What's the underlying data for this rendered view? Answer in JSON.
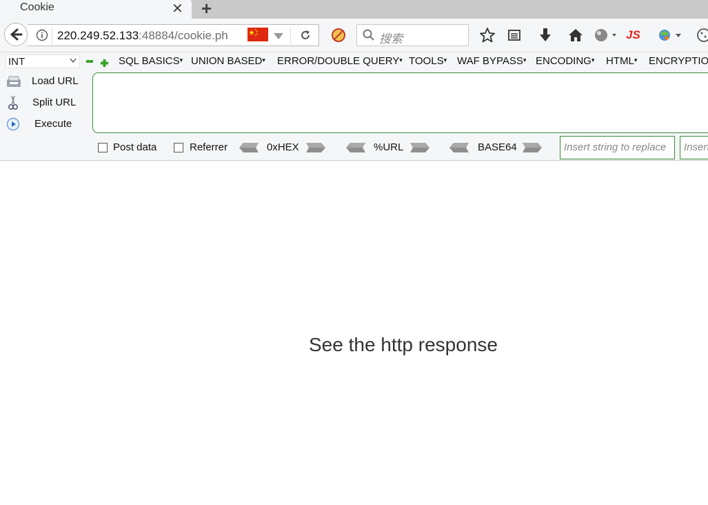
{
  "tab": {
    "title": "Cookie",
    "close": "✕",
    "new_tab": "+"
  },
  "nav": {
    "url_host": "220.249.52.133",
    "url_port": ":48884",
    "url_path": "/cookie.ph",
    "search_placeholder": "搜索",
    "js_label": "JS"
  },
  "hackbar": {
    "select_value": "INT",
    "menus": [
      "SQL BASICS",
      "UNION BASED",
      "ERROR/DOUBLE QUERY",
      "TOOLS",
      "WAF BYPASS",
      "ENCODING",
      "HTML",
      "ENCRYPTION"
    ],
    "load_url": "Load URL",
    "split_url": "Split URL",
    "execute": "Execute",
    "post_data": "Post data",
    "referrer": "Referrer",
    "hex": "0xHEX",
    "url_enc": "%URL",
    "base64": "BASE64",
    "replace_placeholder": "Insert string to replace",
    "replace_with_placeholder": "Insert"
  },
  "page": {
    "message": "See the http response"
  },
  "colors": {
    "accent_green": "#3b8a3b",
    "js_red": "#e1241b"
  }
}
